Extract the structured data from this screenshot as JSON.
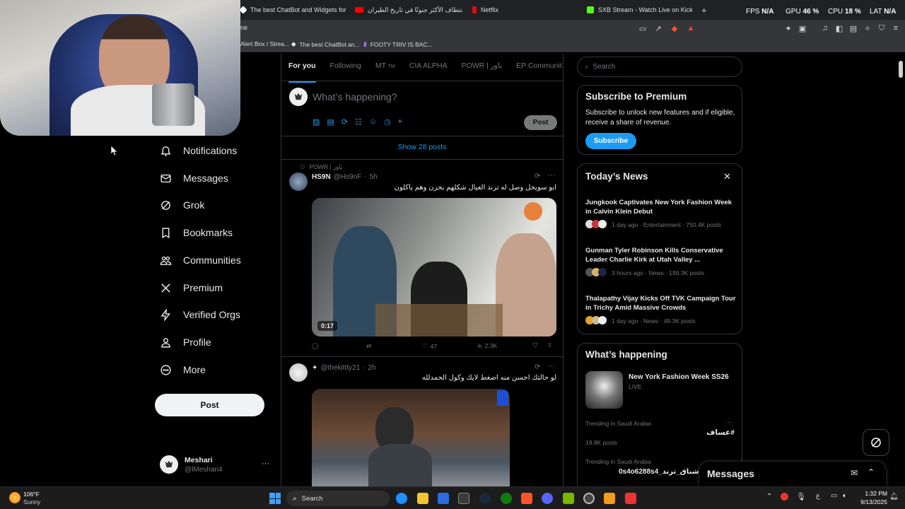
{
  "browser": {
    "tabs": [
      {
        "title": "The best ChatBot and Widgets for Kic",
        "color": "#ffffff"
      },
      {
        "title": "الاختطاف الأكثر جنونًا في تاريخ الطيران",
        "color": "#ff0000"
      },
      {
        "title": "Netflix",
        "color": "#e50914"
      },
      {
        "title": "SXB Stream - Watch Live on Kick",
        "color": "#53fc18"
      }
    ],
    "new_tab": "+",
    "url_fragment": "ne",
    "bookmarks": [
      "Alert Box / Strea...",
      "The best ChatBot an...",
      "FOOTY TRIV IS BAC..."
    ]
  },
  "hud": {
    "fps_label": "FPS",
    "fps_value": "N/A",
    "gpu_label": "GPU",
    "gpu_value": "46",
    "cpu_label": "CPU",
    "cpu_value": "18",
    "lat_label": "LAT",
    "lat_value": "N/A"
  },
  "nav": {
    "items": [
      {
        "label": "Notifications",
        "icon": "bell-icon"
      },
      {
        "label": "Messages",
        "icon": "envelope-icon"
      },
      {
        "label": "Grok",
        "icon": "grok-icon"
      },
      {
        "label": "Bookmarks",
        "icon": "bookmark-icon"
      },
      {
        "label": "Communities",
        "icon": "communities-icon"
      },
      {
        "label": "Premium",
        "icon": "x-logo-icon"
      },
      {
        "label": "Verified Orgs",
        "icon": "lightning-icon"
      },
      {
        "label": "Profile",
        "icon": "person-icon"
      },
      {
        "label": "More",
        "icon": "more-circle-icon"
      }
    ],
    "post_button": "Post",
    "account": {
      "name": "Meshari",
      "handle": "@lMeshari4",
      "more": "···"
    }
  },
  "feed": {
    "tabs": [
      "For you",
      "Following",
      "MT",
      "CIA ALPHA",
      "POWR | باور",
      "EP Communit"
    ],
    "tab_mt_suffix": "TM",
    "composer_placeholder": "What’s happening?",
    "composer_post": "Post",
    "show_posts": "Show 28 posts",
    "post1": {
      "context": "POWR | باور",
      "name": "HS9N",
      "handle": "@Hs9nF",
      "time": "5h",
      "text": "ابو سويحل وصل له ترند العيال شكلهم بحزن وهم ياكلون",
      "video_duration": "0:17",
      "replies": "",
      "reposts": "",
      "likes": "47",
      "views": "2.3K",
      "more": "···"
    },
    "post2": {
      "handle": "@thekittty21",
      "time": "2h",
      "text": "لو حالتك احسن منه اضغط لايك وكول الحمدلله",
      "more": "···"
    }
  },
  "sidebar": {
    "search_placeholder": "Search",
    "premium": {
      "title": "Subscribe to Premium",
      "body": "Subscribe to unlock new features and if eligible, receive a share of revenue.",
      "button": "Subscribe"
    },
    "news": {
      "title": "Today’s News",
      "items": [
        {
          "headline": "Jungkook Captivates New York Fashion Week in Calvin Klein Debut",
          "meta": "1 day ago · Entertainment · 750.4K posts"
        },
        {
          "headline": "Gunman Tyler Robinson Kills Conservative Leader Charlie Kirk at Utah Valley ...",
          "meta": "3 hours ago · News · 199.3K posts"
        },
        {
          "headline": "Thalapathy Vijay Kicks Off TVK Campaign Tour in Trichy Amid Massive Crowds",
          "meta": "1 day ago · News · 49.3K posts"
        }
      ]
    },
    "happening": {
      "title": "What’s happening",
      "event_title": "New York Fashion Week SS26",
      "event_status": "LIVE",
      "trend1_context": "Trending in Saudi Arabia",
      "trend1_name": "#عساف",
      "trend1_count": "19.8K posts",
      "trend2_context": "Trending in Saudi Arabia",
      "trend2_name": "0s4o6288s4_شناق_ترند"
    },
    "messages_drawer": "Messages"
  },
  "taskbar": {
    "weather_temp": "106°F",
    "weather_desc": "Sunny",
    "search": "Search",
    "time": "1:32 PM",
    "date": "9/13/2025",
    "lang": "ع"
  }
}
